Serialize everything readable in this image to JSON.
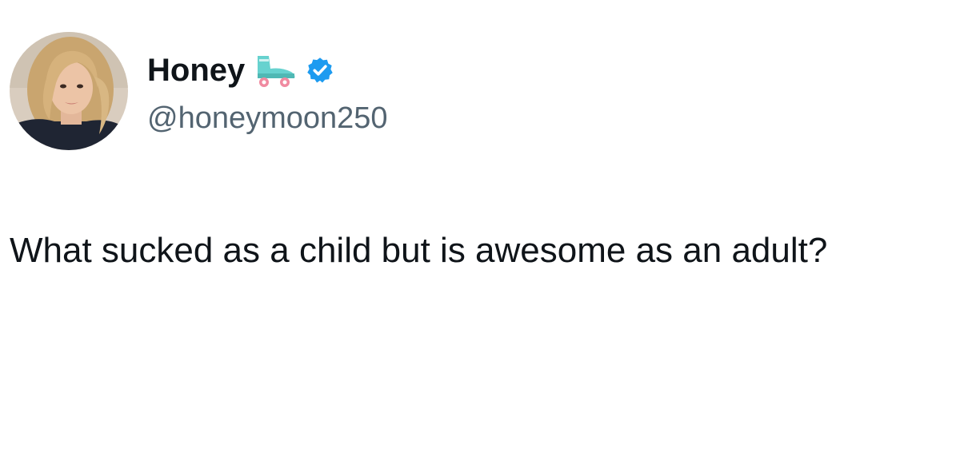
{
  "author": {
    "display_name": "Honey",
    "handle": "@honeymoon250",
    "name_emoji": "roller-skate-icon",
    "verified_icon": "verified-badge-icon",
    "verified_color": "#1d9bf0"
  },
  "tweet": {
    "text": "What sucked as a child but is awesome as an adult?"
  },
  "colors": {
    "text_primary": "#0f1419",
    "text_secondary": "#536471",
    "background": "#ffffff"
  }
}
